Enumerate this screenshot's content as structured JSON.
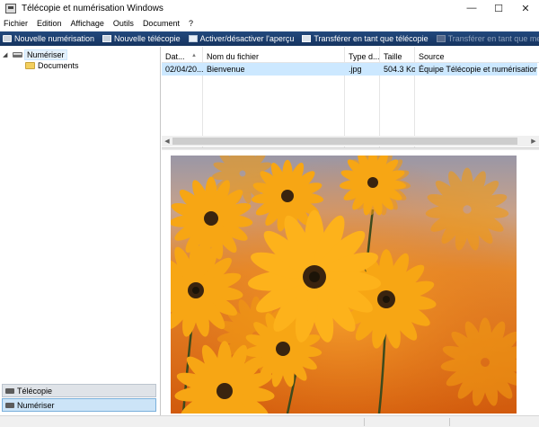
{
  "window": {
    "title": "Télécopie et numérisation Windows",
    "controls": {
      "minimize": "—",
      "maximize": "☐",
      "close": "✕"
    }
  },
  "menu": [
    "Fichier",
    "Edition",
    "Affichage",
    "Outils",
    "Document",
    "?"
  ],
  "toolbar": {
    "new_scan": "Nouvelle numérisation",
    "new_fax": "Nouvelle télécopie",
    "toggle_preview": "Activer/désactiver l'aperçu",
    "forward_fax": "Transférer en tant que télécopie",
    "forward_email": "Transférer en tant que message électronique"
  },
  "tree": {
    "root": "Numériser",
    "child": "Documents"
  },
  "nav": {
    "fax": "Télécopie",
    "scan": "Numériser"
  },
  "list": {
    "columns": [
      "Dat...",
      "Nom du fichier",
      "Type d...",
      "Taille",
      "Source"
    ],
    "rows": [
      {
        "date": "02/04/20...",
        "name": "Bienvenue",
        "type": ".jpg",
        "size": "504.3 Ko",
        "source": "Équipe Télécopie et numérisation Windows"
      }
    ]
  },
  "colors": {
    "toolbar_bg": "#1d3f6e",
    "selection": "#cce8ff",
    "nav_selected": "#cce4f7"
  }
}
